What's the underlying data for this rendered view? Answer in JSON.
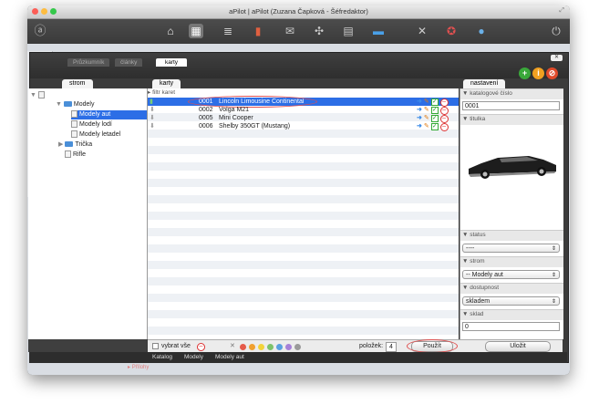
{
  "window": {
    "title": "aPilot | aPilot (Zuzana Čapková - Šéfredaktor)"
  },
  "modal": {
    "tabs": [
      {
        "label": "Průzkumník"
      },
      {
        "label": "články"
      },
      {
        "label": "karty"
      }
    ],
    "panel_tabs": {
      "tree": "strom",
      "cards": "karty",
      "settings": "nastavení"
    }
  },
  "tree": {
    "items": [
      {
        "label": "Modely"
      },
      {
        "label": "Modely aut"
      },
      {
        "label": "Modely lodí"
      },
      {
        "label": "Modely letadel"
      },
      {
        "label": "Trička"
      },
      {
        "label": "Rifle"
      }
    ]
  },
  "list": {
    "filter_label": "filtr karet",
    "rows": [
      {
        "code": "0001",
        "name": "Lincoln Limousine Continental",
        "selected": true
      },
      {
        "code": "0002",
        "name": "Volga M21",
        "selected": false
      },
      {
        "code": "0005",
        "name": "Mini Cooper",
        "selected": false
      },
      {
        "code": "0006",
        "name": "Shelby 350GT (Mustang)",
        "selected": false
      }
    ]
  },
  "settings": {
    "catalog_label": "katalogové číslo",
    "catalog_value": "0001",
    "photo_label": "titulka",
    "status_label": "status",
    "status_value": "----",
    "tree_label": "strom",
    "tree_value": "-- Modely aut",
    "availability_label": "dostupnost",
    "availability_value": "skladem",
    "stock_label": "sklad",
    "stock_value": "0",
    "save_label": "Uložit"
  },
  "bottom": {
    "select_all_label": "vybrat vše",
    "items_label": "položek:",
    "items_count": "4",
    "apply_label": "Použít",
    "dot_colors": [
      "#e55b4b",
      "#f0a030",
      "#f2d33a",
      "#7cc26b",
      "#5aa0e0",
      "#a680d8",
      "#9a9a9a"
    ]
  },
  "statusbar": {
    "crumbs": [
      "Katalog",
      "Modely",
      "Modely aut"
    ],
    "bg_label": "Přílohy"
  },
  "colors": {
    "selection": "#2c6ee6",
    "highlight_oval": "#e05050"
  }
}
